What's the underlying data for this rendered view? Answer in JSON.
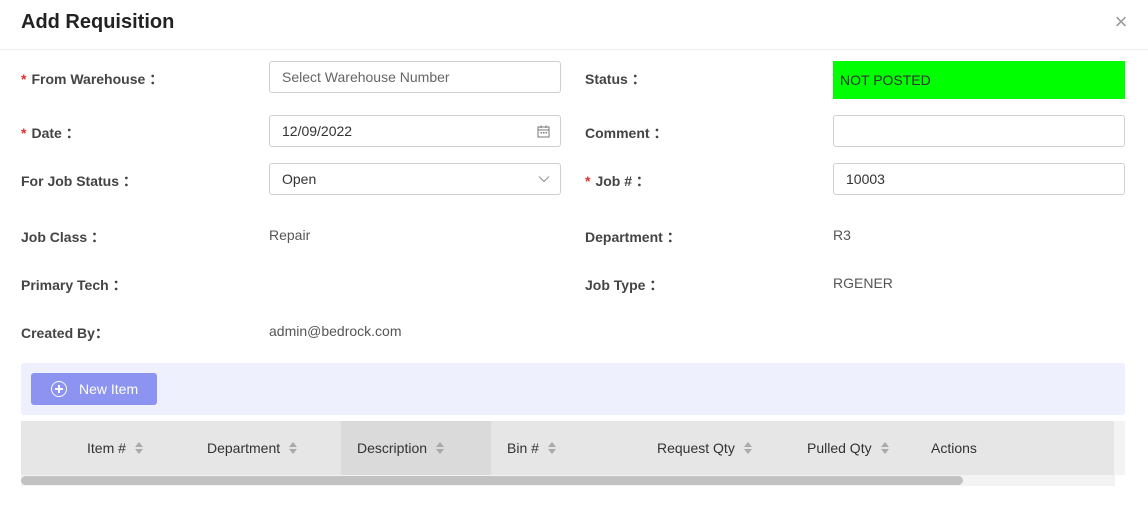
{
  "dialog": {
    "title": "Add Requisition",
    "close_symbol": "×"
  },
  "form": {
    "from_warehouse": {
      "label": "From Warehouse",
      "required": true,
      "value": "",
      "placeholder": "Select Warehouse Number"
    },
    "status": {
      "label": "Status",
      "value": "NOT POSTED",
      "color": "#00ff00"
    },
    "date": {
      "label": "Date",
      "required": true,
      "value": "12/09/2022"
    },
    "comment": {
      "label": "Comment",
      "value": ""
    },
    "for_job_status": {
      "label": "For Job Status",
      "value": "Open"
    },
    "job_number": {
      "label": "Job #",
      "required": true,
      "value": "10003"
    },
    "job_class": {
      "label": "Job Class",
      "value": "Repair"
    },
    "department": {
      "label": "Department",
      "value": "R3"
    },
    "primary_tech": {
      "label": "Primary Tech",
      "value": ""
    },
    "job_type": {
      "label": "Job Type",
      "value": "RGENER"
    },
    "created_by": {
      "label": "Created By",
      "value": "admin@bedrock.com"
    }
  },
  "colon": "：",
  "toolbar": {
    "new_item_label": "New Item",
    "new_item_icon": "plus-circle-icon",
    "accent": "#8c93f0"
  },
  "table": {
    "columns": [
      "Item #",
      "Department",
      "Description",
      "Bin #",
      "Request Qty",
      "Pulled Qty",
      "Actions"
    ]
  }
}
